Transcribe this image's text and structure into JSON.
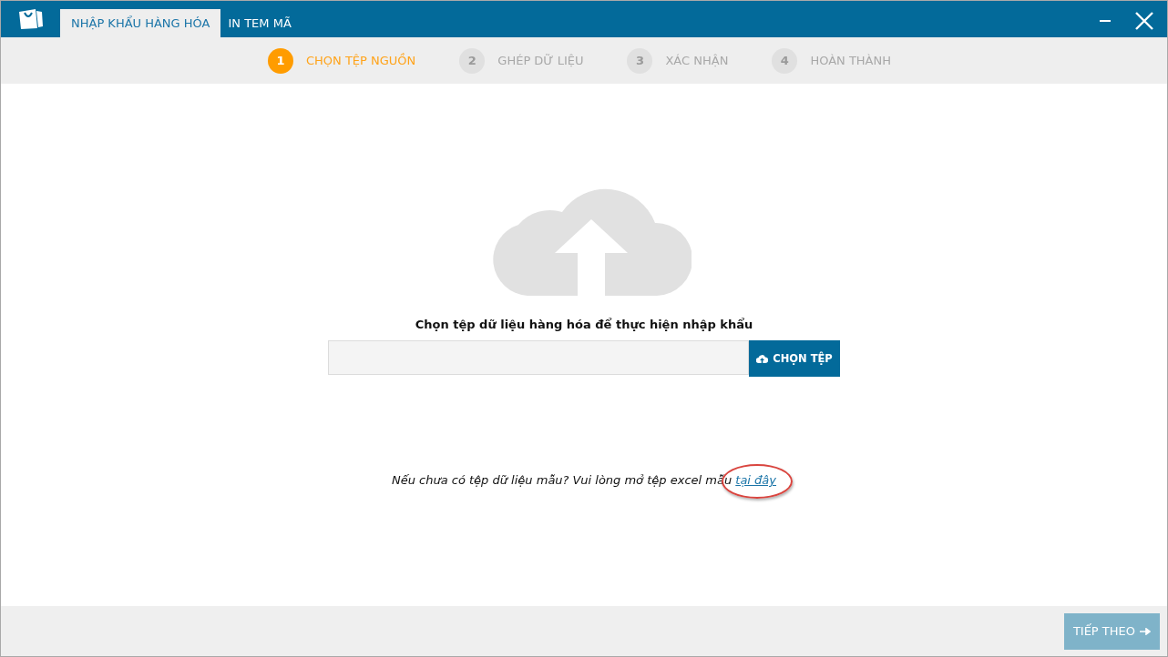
{
  "window": {
    "tabs": [
      {
        "label": "NHẬP KHẨU HÀNG HÓA",
        "selected": true
      },
      {
        "label": "IN TEM MÃ",
        "selected": false
      }
    ]
  },
  "steps": [
    {
      "number": "1",
      "label": "CHỌN TỆP NGUỒN",
      "selected": true
    },
    {
      "number": "2",
      "label": "GHÉP DỮ LIỆU",
      "selected": false
    },
    {
      "number": "3",
      "label": "XÁC NHẬN",
      "selected": false
    },
    {
      "number": "4",
      "label": "HOÀN THÀNH",
      "selected": false
    }
  ],
  "upload": {
    "title": "Chọn tệp dữ liệu hàng hóa để thực hiện nhập khẩu",
    "button": "CHỌN TỆP"
  },
  "hint": {
    "text": "Nếu chưa có tệp dữ liệu mẫu? Vui lòng mở tệp excel mẫu",
    "link": "tại đây"
  },
  "footer": {
    "next_button": {
      "label": "TIẾP THEO",
      "disabled": true
    }
  }
}
